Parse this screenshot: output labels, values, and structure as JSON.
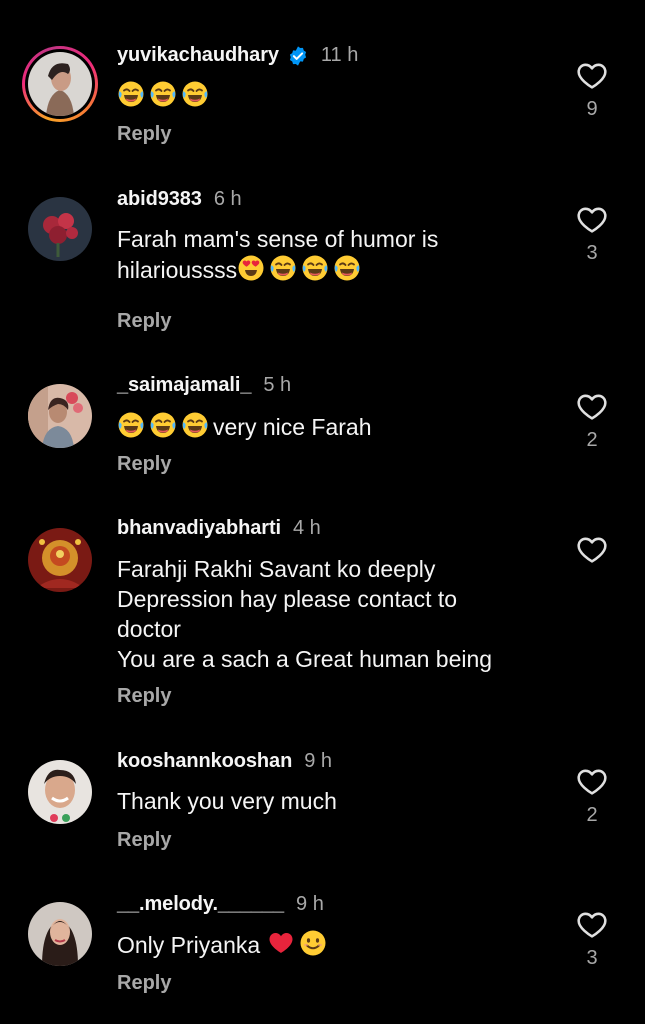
{
  "comments": [
    {
      "username": "yuvikachaudhary",
      "verified": true,
      "time": "11 h",
      "text_suffix": "",
      "emojis": [
        "joy-emoji",
        "joy-emoji",
        "joy-emoji"
      ],
      "reply_label": "Reply",
      "likes": "9"
    },
    {
      "username": "abid9383",
      "time": "6 h",
      "text_line1": "Farah mam's sense of humor is",
      "text_line2": "hilarioussss",
      "emojis": [
        "heart-eyes-emoji",
        "joy-emoji",
        "joy-emoji",
        "joy-emoji"
      ],
      "reply_label": "Reply",
      "likes": "3"
    },
    {
      "username": "_saimajamali_",
      "time": "5 h",
      "text": "very nice Farah",
      "emojis": [
        "joy-emoji",
        "joy-emoji",
        "joy-emoji"
      ],
      "reply_label": "Reply",
      "likes": "2"
    },
    {
      "username": "bhanvadiyabharti",
      "time": "4 h",
      "text_lines": [
        "Farahji Rakhi Savant ko deeply",
        "Depression hay please contact to",
        "doctor",
        "You are a sach a Great human being"
      ],
      "reply_label": "Reply",
      "likes": ""
    },
    {
      "username": "kooshannkooshan",
      "time": "9 h",
      "text": "Thank you very much",
      "reply_label": "Reply",
      "likes": "2"
    },
    {
      "username": "__.melody.______",
      "time": "9 h",
      "text": "Only Priyanka",
      "emojis": [
        "red-heart-emoji",
        "smiling-emoji"
      ],
      "reply_label": "Reply",
      "likes": "3"
    }
  ],
  "colors": {
    "background": "#000000",
    "primary_text": "#f5f5f5",
    "secondary_text": "#a8a8a8",
    "verified_blue": "#0095f6"
  },
  "icons": {
    "like": "heart-outline-icon",
    "verified": "verified-badge-icon"
  }
}
